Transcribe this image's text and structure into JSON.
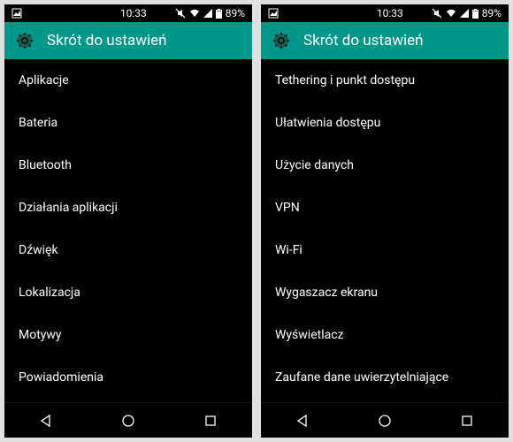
{
  "status": {
    "time": "10:33",
    "battery": "89%"
  },
  "header": {
    "title": "Skrót do ustawień"
  },
  "list_left": [
    "Aplikacje",
    "Bateria",
    "Bluetooth",
    "Działania aplikacji",
    "Dźwięk",
    "Lokalizacja",
    "Motywy",
    "Powiadomienia"
  ],
  "list_right": [
    "Tethering i punkt dostępu",
    "Ułatwienia dostępu",
    "Użycie danych",
    "VPN",
    "Wi-Fi",
    "Wygaszacz ekranu",
    "Wyświetlacz",
    "Zaufane dane uwierzytelniające"
  ]
}
